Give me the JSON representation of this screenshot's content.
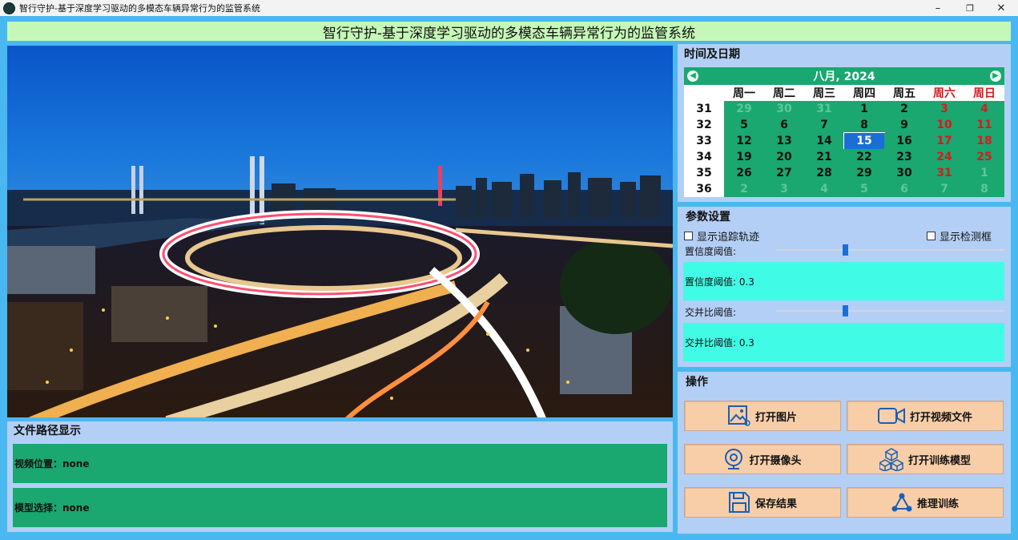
{
  "window": {
    "title": "智行守护-基于深度学习驱动的多模态车辆异常行为的监管系统",
    "controls": [
      "–",
      "❐",
      "✕"
    ]
  },
  "banner": "智行守护-基于深度学习驱动的多模态车辆异常行为的监管系统",
  "datetime": {
    "title": "时间及日期",
    "month_label": "八月, 2024",
    "weekday_headers": [
      "周一",
      "周二",
      "周三",
      "周四",
      "周五",
      "周六",
      "周日"
    ],
    "weeks": [
      {
        "wk": "31",
        "days": [
          "29",
          "30",
          "31",
          "1",
          "2",
          "3",
          "4"
        ]
      },
      {
        "wk": "32",
        "days": [
          "5",
          "6",
          "7",
          "8",
          "9",
          "10",
          "11"
        ]
      },
      {
        "wk": "33",
        "days": [
          "12",
          "13",
          "14",
          "15",
          "16",
          "17",
          "18"
        ]
      },
      {
        "wk": "34",
        "days": [
          "19",
          "20",
          "21",
          "22",
          "23",
          "24",
          "25"
        ]
      },
      {
        "wk": "35",
        "days": [
          "26",
          "27",
          "28",
          "29",
          "30",
          "31",
          "1"
        ]
      },
      {
        "wk": "36",
        "days": [
          "2",
          "3",
          "4",
          "5",
          "6",
          "7",
          "8"
        ]
      }
    ],
    "selected_day": "15"
  },
  "params": {
    "title": "参数设置",
    "show_track": "显示追踪轨迹",
    "show_box": "显示检测框",
    "conf_label": "置信度阈值:",
    "conf_value": 0.3,
    "conf_display": "置信度阈值: 0.3",
    "iou_label": "交并比阈值:",
    "iou_value": 0.3,
    "iou_display": "交并比阈值: 0.3"
  },
  "ops": {
    "title": "操作",
    "open_image": "打开图片",
    "open_video": "打开视频文件",
    "open_camera": "打开摄像头",
    "open_model": "打开训练模型",
    "save_result": "保存结果",
    "infer_train": "推理训练"
  },
  "filepath": {
    "title": "文件路径显示",
    "video": "视频位置：none",
    "model": "模型选择：none"
  },
  "colors": {
    "accent_green": "#1aa770",
    "cyan": "#40fbe5",
    "button": "#f8cea8",
    "today": "#1a6fd6",
    "weekend": "#e0161c"
  }
}
